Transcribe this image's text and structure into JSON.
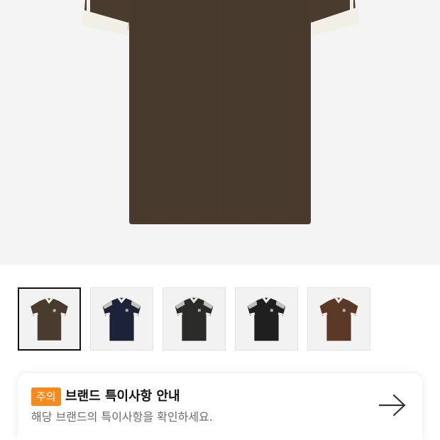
{
  "product_image": {
    "icon": "polo-shirt-image",
    "shirt_color": "#4a3b2f",
    "trim_color": "#f2efe6"
  },
  "thumbnails": [
    {
      "icon": "polo-shirt-thumbnail",
      "body": "#4a3b2f",
      "trim": "#f2efe6",
      "stripe": "#4a3b2f",
      "selected": true
    },
    {
      "icon": "polo-shirt-thumbnail",
      "body": "#1c2238",
      "trim": "#ece9e0",
      "stripe": "#d8d4c8",
      "selected": false
    },
    {
      "icon": "polo-shirt-thumbnail",
      "body": "#2a2a28",
      "trim": "#e6e4dc",
      "stripe": "#cfcfc8",
      "selected": false
    },
    {
      "icon": "polo-shirt-thumbnail",
      "body": "#1f1f1f",
      "trim": "#eeeeea",
      "stripe": "#d2d2cc",
      "selected": false
    },
    {
      "icon": "polo-shirt-thumbnail",
      "body": "#5a3a26",
      "trim": "#efe8dc",
      "stripe": "#5a3a26",
      "selected": false
    }
  ],
  "notice": {
    "badge": "주의",
    "title": "브랜드 특이사항 안내",
    "description": "해당 브랜드의 특이사항을 확인하세요.",
    "arrow_icon": "arrow-right-icon",
    "badge_color": "#f58a1f"
  }
}
